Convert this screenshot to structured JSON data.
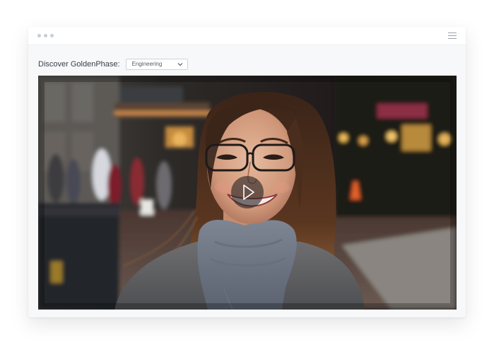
{
  "toolbar": {
    "label": "Discover GoldenPhase:",
    "select_value": "Engineering"
  },
  "icons": {
    "window_dots": "window-control-dots",
    "menu": "hamburger-menu-icon",
    "select_arrow": "chevron-down-icon",
    "play": "play-icon"
  },
  "video": {
    "subject": "photo-of-smiling-woman-with-glasses-on-city-street"
  },
  "colors": {
    "window_bg": "#f7f8fa",
    "titlebar_bg": "#ffffff",
    "select_border": "#cfd3d8",
    "play_overlay": "#282426"
  }
}
